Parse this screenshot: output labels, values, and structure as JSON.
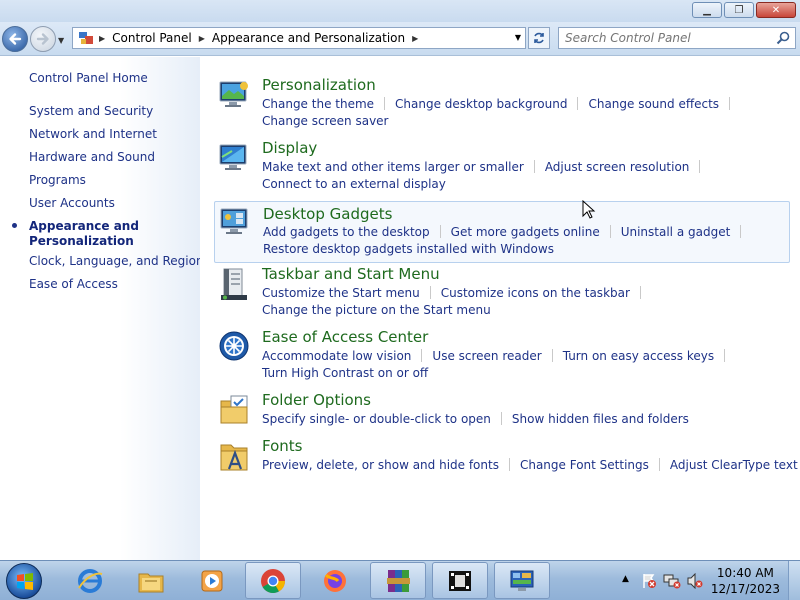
{
  "window": {
    "minimize_glyph": "▁",
    "maximize_glyph": "❐",
    "close_glyph": "✕"
  },
  "address": {
    "breadcrumbs": [
      "Control Panel",
      "Appearance and Personalization"
    ],
    "search_placeholder": "Search Control Panel"
  },
  "sidebar": {
    "home": "Control Panel Home",
    "items": [
      "System and Security",
      "Network and Internet",
      "Hardware and Sound",
      "Programs",
      "User Accounts",
      "Appearance and",
      "Personalization",
      "Clock, Language, and Region",
      "Ease of Access"
    ]
  },
  "categories": [
    {
      "title": "Personalization",
      "icon": "personalization-icon",
      "rows": [
        [
          "Change the theme",
          "Change desktop background",
          "Change sound effects"
        ],
        [
          "Change screen saver"
        ]
      ]
    },
    {
      "title": "Display",
      "icon": "display-icon",
      "rows": [
        [
          "Make text and other items larger or smaller",
          "Adjust screen resolution"
        ],
        [
          "Connect to an external display"
        ]
      ]
    },
    {
      "title": "Desktop Gadgets",
      "icon": "gadgets-icon",
      "rows": [
        [
          "Add gadgets to the desktop",
          "Get more gadgets online",
          "Uninstall a gadget"
        ],
        [
          "Restore desktop gadgets installed with Windows"
        ]
      ]
    },
    {
      "title": "Taskbar and Start Menu",
      "icon": "taskbar-icon",
      "rows": [
        [
          "Customize the Start menu",
          "Customize icons on the taskbar"
        ],
        [
          "Change the picture on the Start menu"
        ]
      ]
    },
    {
      "title": "Ease of Access Center",
      "icon": "ease-of-access-icon",
      "rows": [
        [
          "Accommodate low vision",
          "Use screen reader",
          "Turn on easy access keys"
        ],
        [
          "Turn High Contrast on or off"
        ]
      ]
    },
    {
      "title": "Folder Options",
      "icon": "folder-options-icon",
      "rows": [
        [
          "Specify single- or double-click to open",
          "Show hidden files and folders"
        ]
      ]
    },
    {
      "title": "Fonts",
      "icon": "fonts-icon",
      "rows": [
        [
          "Preview, delete, or show and hide fonts",
          "Change Font Settings",
          "Adjust ClearType text"
        ]
      ]
    }
  ],
  "taskbar": {
    "apps": [
      "internet-explorer-icon",
      "windows-explorer-icon",
      "media-player-icon",
      "chrome-icon",
      "firefox-icon",
      "winrar-icon",
      "video-app-icon",
      "control-panel-icon"
    ],
    "time": "10:40 AM",
    "date": "12/17/2023"
  }
}
